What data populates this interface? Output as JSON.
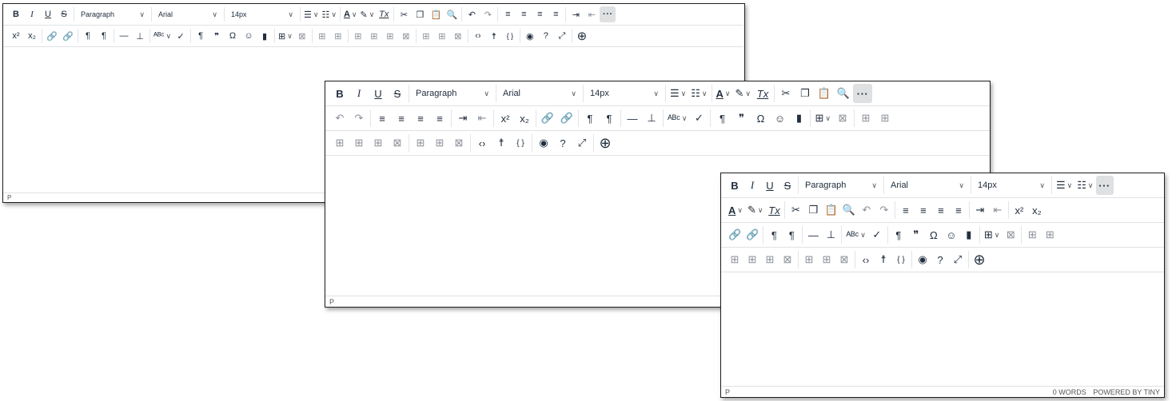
{
  "colors": {
    "icon": "#222f3e",
    "border": "#1f1f1f",
    "divider": "#dfe1e5",
    "more_bg": "#dee0e2"
  },
  "format": {
    "block": "Paragraph",
    "font": "Arial",
    "size": "14px"
  },
  "glyphs": {
    "bold": "B",
    "italic": "I",
    "underline": "U",
    "strike": "S",
    "superscript": "x²",
    "subscript": "x₂",
    "bullets": "☰",
    "numbered": "☷",
    "undo": "↶",
    "redo": "↷",
    "link": "🔗",
    "ltr": "¶",
    "rtl": "¶",
    "hr": "—",
    "checkmark": "✓",
    "pilcrow": "¶",
    "quote": "❞",
    "omega": "Ω",
    "smiley": "☺",
    "bookmark": "▮",
    "code": "‹›",
    "accessibility": "☨",
    "variable": "{ }",
    "preview": "◉",
    "help": "?",
    "fullscreen": "⤢",
    "add": "⊕",
    "more": "···",
    "clear": "Tx",
    "text_color": "A",
    "highlight": "✎",
    "cut": "✂",
    "copy": "❐",
    "paste": "📋",
    "find": "🔍",
    "align_left": "≡",
    "align_center": "≡",
    "align_right": "≡",
    "justify": "≡",
    "indent": "⇥",
    "outdent": "⇤",
    "spell": "ᴬᴮᶜ",
    "table": "⊞",
    "table_cell": "⊞",
    "table_delete": "⊠",
    "caret": "∨"
  },
  "editors": [
    {
      "status_path": "P"
    },
    {
      "status_path": "P"
    },
    {
      "status_path": "P",
      "word_count": "0 WORDS",
      "powered_by": "POWERED BY TINY"
    }
  ]
}
